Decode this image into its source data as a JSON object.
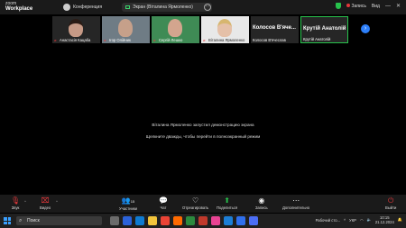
{
  "app": {
    "brand_top": "zoom",
    "brand_bottom": "Workplace",
    "conference_label": "Конференция"
  },
  "share_bar": {
    "title": "Экран (Віталина Ярмоленко)",
    "more": "⋯"
  },
  "top_right": {
    "record_label": "Запись",
    "view_label": "Вид",
    "minimize": "—",
    "close": "✕"
  },
  "thumbnails": [
    {
      "name": "Анастасія Кацаба"
    },
    {
      "name": "Ігор Олійник"
    },
    {
      "name": "Сергій Лешко"
    },
    {
      "name": "Віталина Ярмоленко"
    }
  ],
  "name_tiles": [
    {
      "big": "Колосов В'яче...",
      "small": "Колосов В'ячеслав"
    },
    {
      "big": "Крутій Анатолій",
      "small": "Крутій Анатолій"
    }
  ],
  "next_arrow": "›",
  "messages": {
    "line1": "Віталина Ярмоленко запустил демонстрацию экрана",
    "line2": "Щелкните дважды, чтобы перейти в полноэкранный режим"
  },
  "toolbar": {
    "audio": "Звук",
    "video": "Видео",
    "participants": "Участники",
    "participants_count": "15",
    "chat": "Чат",
    "react": "Отреагировать",
    "share": "Поделиться",
    "record": "Запись",
    "more": "Дополнительно",
    "leave": "Выйти"
  },
  "taskbar": {
    "search_placeholder": "Поиск",
    "desktop_label": "Рабочий сто...",
    "lang": "УКР",
    "time": "10:15",
    "date": "21.12.2024"
  },
  "colors": {
    "accent_green": "#27c24c",
    "danger_red": "#e5383b",
    "blue": "#2d7ff9"
  }
}
